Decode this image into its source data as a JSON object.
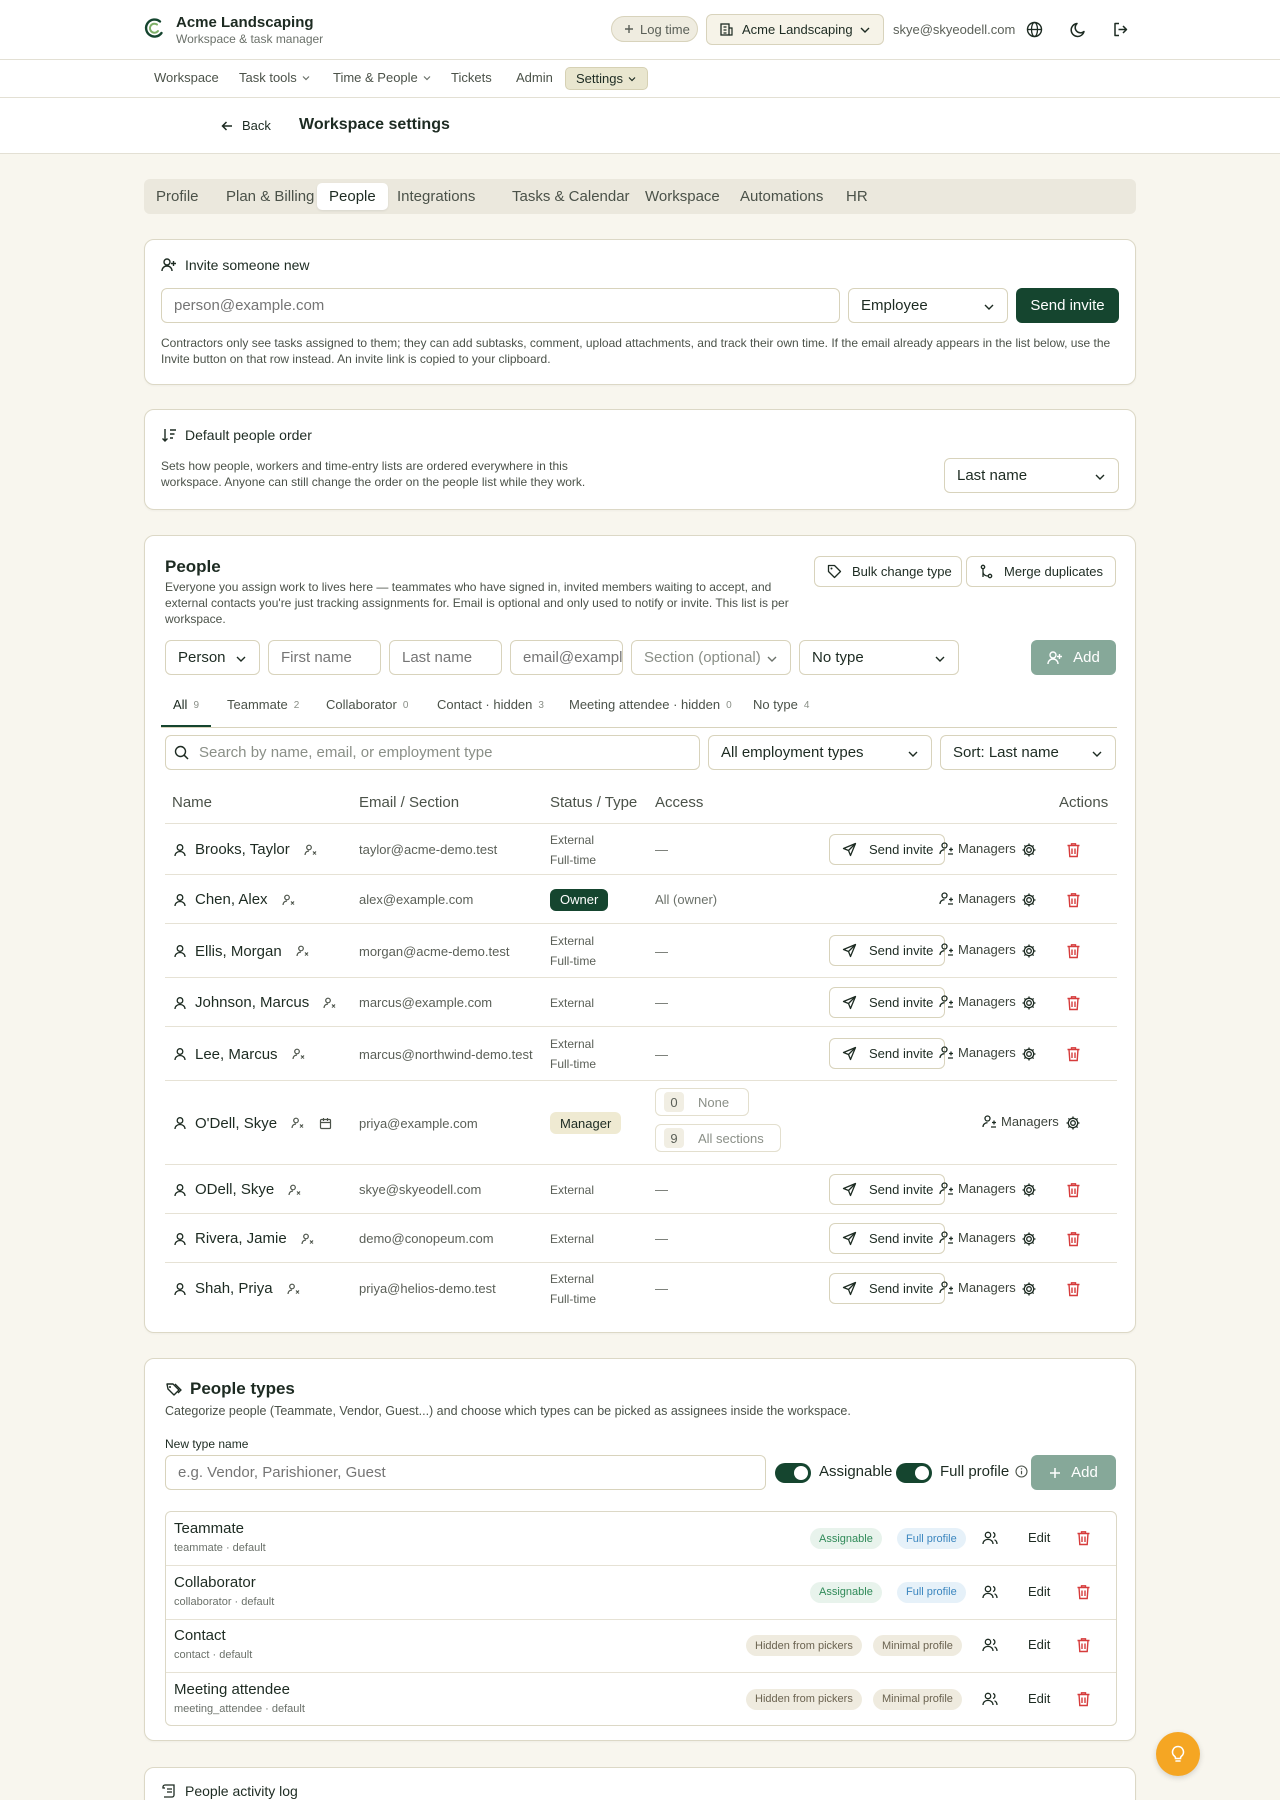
{
  "topbar": {
    "brand_title": "Acme Landscaping",
    "brand_subtitle": "Workspace & task manager",
    "log_time_label": "Log time",
    "workspace_select": "Acme Landscaping",
    "user_email": "skye@skyeodell.com"
  },
  "subnav": {
    "items": [
      "Workspace",
      "Task tools",
      "Time & People",
      "Tickets",
      "Admin",
      "Settings"
    ]
  },
  "header": {
    "back_label": "Back",
    "title": "Workspace settings"
  },
  "tabs": [
    "Profile",
    "Plan & Billing",
    "People",
    "Integrations",
    "Tasks & Calendar",
    "Workspace",
    "Automations",
    "HR"
  ],
  "invite": {
    "title": "Invite someone new",
    "email_placeholder": "person@example.com",
    "role_value": "Employee",
    "send_label": "Send invite",
    "note": "Contractors only see tasks assigned to them; they can add subtasks, comment, upload attachments, and track their own time. If the email already appears in the list below, use the Invite button on that row instead. An invite link is copied to your clipboard."
  },
  "order": {
    "title": "Default people order",
    "desc": "Sets how people, workers and time-entry lists are ordered everywhere in this workspace. Anyone can still change the order on the people list while they work.",
    "value": "Last name"
  },
  "people": {
    "title": "People",
    "desc": "Everyone you assign work to lives here — teammates who have signed in, invited members waiting to accept, and external contacts you're just tracking assignments for. Email is optional and only used to notify or invite. This list is per workspace.",
    "bulk_label": "Bulk change type",
    "merge_label": "Merge duplicates",
    "form": {
      "kind": "Person",
      "first_placeholder": "First name",
      "last_placeholder": "Last name",
      "email_placeholder": "email@example.",
      "section_placeholder": "Section (optional)",
      "type_value": "No type",
      "add_label": "Add"
    },
    "filters": [
      {
        "label": "All",
        "count": "9"
      },
      {
        "label": "Teammate",
        "count": "2"
      },
      {
        "label": "Collaborator",
        "count": "0"
      },
      {
        "label": "Contact · hidden",
        "count": "3"
      },
      {
        "label": "Meeting attendee · hidden",
        "count": "0"
      },
      {
        "label": "No type",
        "count": "4"
      }
    ],
    "search_placeholder": "Search by name, email, or employment type",
    "employment_filter": "All employment types",
    "sort_value": "Sort: Last name",
    "columns": {
      "name": "Name",
      "email": "Email / Section",
      "status": "Status / Type",
      "access": "Access",
      "actions": "Actions"
    },
    "send_invite_label": "Send invite",
    "managers_label": "Managers",
    "rows": [
      {
        "name": "Brooks, Taylor",
        "email": "taylor@acme-demo.test",
        "status": "External",
        "type": "Full-time",
        "access": "—"
      },
      {
        "name": "Chen, Alex",
        "email": "alex@example.com",
        "status": "Owner",
        "type": "",
        "access": "All (owner)"
      },
      {
        "name": "Ellis, Morgan",
        "email": "morgan@acme-demo.test",
        "status": "External",
        "type": "Full-time",
        "access": "—"
      },
      {
        "name": "Johnson, Marcus",
        "email": "marcus@example.com",
        "status": "External",
        "type": "",
        "access": "—"
      },
      {
        "name": "Lee, Marcus",
        "email": "marcus@northwind-demo.test",
        "status": "External",
        "type": "Full-time",
        "access": "—"
      },
      {
        "name": "O'Dell, Skye",
        "email": "priya@example.com",
        "status": "Manager",
        "type": "",
        "access_none_count": "0",
        "access_none_label": "None",
        "access_all_count": "9",
        "access_all_label": "All sections"
      },
      {
        "name": "ODell, Skye",
        "email": "skye@skyeodell.com",
        "status": "External",
        "type": "",
        "access": "—"
      },
      {
        "name": "Rivera, Jamie",
        "email": "demo@conopeum.com",
        "status": "External",
        "type": "",
        "access": "—"
      },
      {
        "name": "Shah, Priya",
        "email": "priya@helios-demo.test",
        "status": "External",
        "type": "Full-time",
        "access": "—"
      }
    ]
  },
  "types": {
    "title": "People types",
    "desc": "Categorize people (Teammate, Vendor, Guest...) and choose which types can be picked as assignees inside the workspace.",
    "new_label": "New type name",
    "new_placeholder": "e.g. Vendor, Parishioner, Guest",
    "assignable_label": "Assignable",
    "full_profile_label": "Full profile",
    "add_label": "Add",
    "edit_label": "Edit",
    "list": [
      {
        "name": "Teammate",
        "sub": "teammate · default",
        "tag1": "Assignable",
        "tag2": "Full profile"
      },
      {
        "name": "Collaborator",
        "sub": "collaborator · default",
        "tag1": "Assignable",
        "tag2": "Full profile"
      },
      {
        "name": "Contact",
        "sub": "contact · default",
        "tag1": "Hidden from pickers",
        "tag2": "Minimal profile"
      },
      {
        "name": "Meeting attendee",
        "sub": "meeting_attendee · default",
        "tag1": "Hidden from pickers",
        "tag2": "Minimal profile"
      }
    ]
  },
  "activity": {
    "title": "People activity log"
  },
  "colors": {
    "accent": "#15452f",
    "background": "#f8f6ee",
    "danger": "#d63b3b",
    "fab": "#f5a623"
  }
}
